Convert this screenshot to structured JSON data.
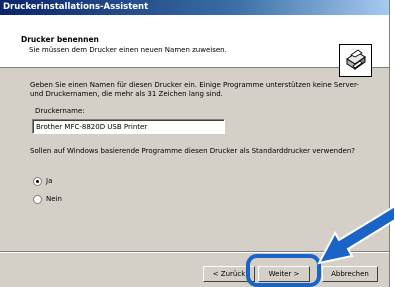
{
  "window": {
    "title": "Druckerinstallations-Assistent"
  },
  "header": {
    "title": "Drucker benennen",
    "subtitle": "Sie müssen dem Drucker einen neuen Namen zuweisen."
  },
  "body": {
    "instruction": "Geben Sie einen Namen für diesen Drucker ein. Einige Programme unterstützen keine Server- und Druckernamen, die mehr als 31 Zeichen lang sind.",
    "printer_name_label": "Druckername:",
    "printer_name_value": "Brother MFC-8820D USB Printer",
    "default_question": "Sollen auf Windows basierende Programme diesen Drucker als Standarddrucker verwenden?",
    "options": [
      {
        "label": "Ja",
        "selected": true
      },
      {
        "label": "Nein",
        "selected": false
      }
    ]
  },
  "buttons": {
    "back": "< Zurück",
    "next": "Weiter >",
    "cancel": "Abbrechen"
  },
  "icons": {
    "header_icon": "printer-icon",
    "pointer": "arrow-icon"
  },
  "colors": {
    "highlight": "#1a64c8",
    "titlebar": "#0a246a"
  }
}
